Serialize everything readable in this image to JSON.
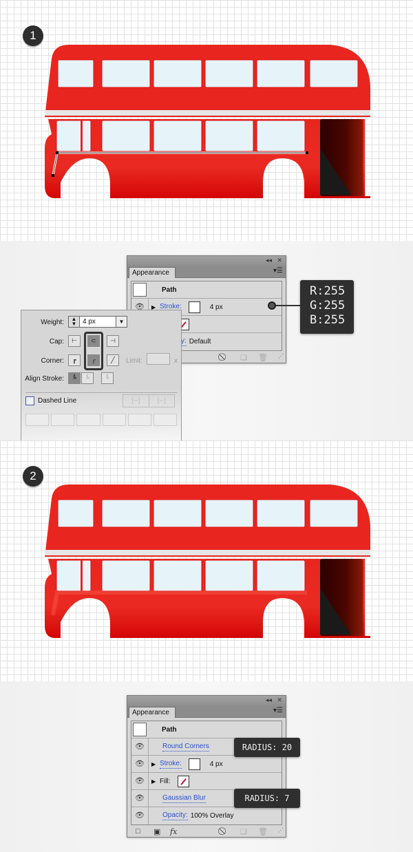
{
  "steps": [
    "1",
    "2"
  ],
  "colors": {
    "bus_red": "#e8261f",
    "bus_dark_red": "#d60a0a",
    "window": "#e6f4fa",
    "tooltip_bg": "#2f2f2f",
    "link": "#2a4fd0"
  },
  "appearance_panel_1": {
    "tab": "Appearance",
    "collapse_icon": "double-arrow-left-icon",
    "close_icon": "close-icon",
    "menu_icon": "panel-menu-icon",
    "rows": [
      {
        "label": "Path"
      },
      {
        "label": "Stroke:",
        "value": "4 px"
      },
      {
        "label": "Fill:"
      },
      {
        "label": "Opacity:",
        "value": "Default"
      }
    ],
    "footer_icons": [
      "clear-appearance-icon",
      "duplicate-item-icon",
      "delete-item-icon"
    ]
  },
  "color_tooltip": {
    "r": "R:255",
    "g": "G:255",
    "b": "B:255"
  },
  "stroke_panel": {
    "weight_label": "Weight:",
    "weight_value": "4 px",
    "cap_label": "Cap:",
    "corner_label": "Corner:",
    "limit_label": "Limit:",
    "limit_suffix": "x",
    "align_label": "Align Stroke:",
    "dashed_label": "Dashed Line",
    "dash_fields": [
      "dash",
      "gap",
      "dash",
      "gap",
      "dash",
      "gap"
    ]
  },
  "appearance_panel_2": {
    "tab": "Appearance",
    "rows": [
      {
        "label": "Path"
      },
      {
        "label": "Round Corners"
      },
      {
        "label": "Stroke:",
        "value": "4 px"
      },
      {
        "label": "Fill:"
      },
      {
        "label": "Gaussian Blur"
      },
      {
        "label": "Opacity:",
        "value": "100% Overlay"
      }
    ],
    "footer_icons": [
      "add-stroke-icon",
      "add-fill-icon",
      "fx-icon",
      "clear-appearance-icon",
      "duplicate-item-icon",
      "delete-item-icon"
    ],
    "fx_label": "fx"
  },
  "radius_tooltips": [
    "RADIUS: 20",
    "RADIUS: 7"
  ]
}
